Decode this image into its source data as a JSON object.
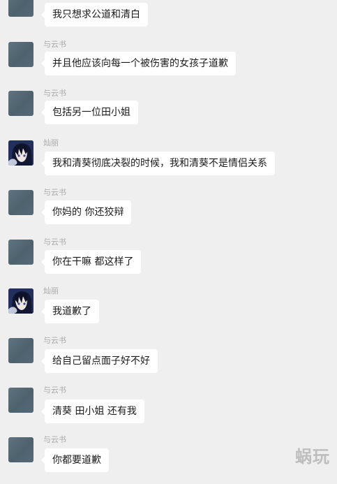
{
  "messages": [
    {
      "sender": "",
      "avatar": "gray-avatar",
      "text": "我只想求公道和清白"
    },
    {
      "sender": "与云书",
      "avatar": "gray-avatar",
      "text": "并且他应该向每一个被伤害的女孩子道歉"
    },
    {
      "sender": "与云书",
      "avatar": "gray-avatar",
      "text": "包括另一位田小姐"
    },
    {
      "sender": "灿丽",
      "avatar": "anime-avatar",
      "text": "我和清葵彻底决裂的时候，我和清葵不是情侣关系"
    },
    {
      "sender": "与云书",
      "avatar": "gray-avatar",
      "text": "你妈的 你还狡辩"
    },
    {
      "sender": "与云书",
      "avatar": "gray-avatar",
      "text": "你在干嘛 都这样了"
    },
    {
      "sender": "灿丽",
      "avatar": "anime-avatar",
      "text": "我道歉了"
    },
    {
      "sender": "与云书",
      "avatar": "gray-avatar",
      "text": "给自己留点面子好不好"
    },
    {
      "sender": "与云书",
      "avatar": "gray-avatar",
      "text": "清葵 田小姐 还有我"
    },
    {
      "sender": "与云书",
      "avatar": "gray-avatar",
      "text": "你都要道歉"
    }
  ],
  "watermark": "蜗玩"
}
